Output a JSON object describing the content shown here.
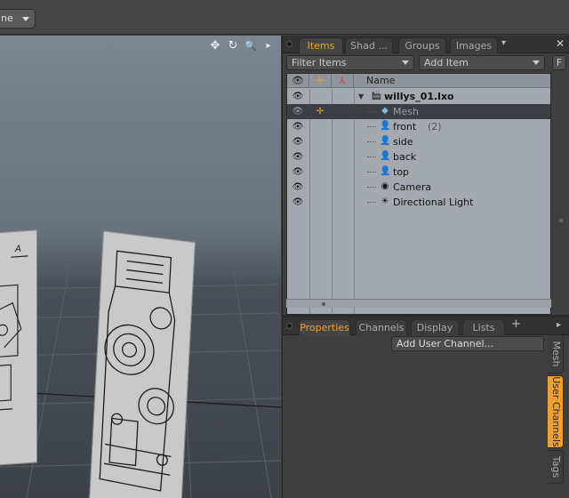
{
  "toolbar": {
    "mode_label": "ne"
  },
  "viewport": {
    "tools": [
      {
        "name": "move-view-icon",
        "glyph": "✥"
      },
      {
        "name": "rotate-view-icon",
        "glyph": "↻"
      },
      {
        "name": "zoom-view-icon",
        "glyph": "🔍"
      },
      {
        "name": "viewport-menu-icon",
        "glyph": "▸"
      }
    ],
    "annotation": "A"
  },
  "top_tabs": {
    "items": [
      {
        "label": "Items",
        "active": true
      },
      {
        "label": "Shad ...",
        "active": false
      },
      {
        "label": "Groups",
        "active": false
      },
      {
        "label": "Images",
        "active": false
      }
    ],
    "more_glyph": "▾",
    "close_glyph": "✕"
  },
  "filter": {
    "filter_label": "Filter Items",
    "add_label": "Add Item",
    "f_label": "F"
  },
  "tree": {
    "header": {
      "name_label": "Name"
    },
    "header_icons": [
      "eye-icon",
      "lock-icon",
      "axes-icon"
    ],
    "colors": {
      "selected_row": "#3b3f44",
      "accent": "#f0a030",
      "bg": "#a3a9ae"
    },
    "rows": [
      {
        "label": "willys_01.lxo",
        "extra": "",
        "icon": "scene-icon",
        "glyph": "🎬",
        "indent": 0,
        "bold": true,
        "selected": false,
        "eye": true,
        "lock": false,
        "expand": true
      },
      {
        "label": "Mesh",
        "extra": "",
        "icon": "mesh-icon",
        "glyph": "◆",
        "indent": 1,
        "bold": false,
        "selected": true,
        "eye": true,
        "lock": true,
        "expand": false
      },
      {
        "label": "front",
        "extra": "(2)",
        "icon": "image-icon",
        "glyph": "👤",
        "indent": 1,
        "bold": false,
        "selected": false,
        "eye": true,
        "lock": false,
        "expand": false
      },
      {
        "label": "side",
        "extra": "",
        "icon": "image-icon",
        "glyph": "👤",
        "indent": 1,
        "bold": false,
        "selected": false,
        "eye": true,
        "lock": false,
        "expand": false
      },
      {
        "label": "back",
        "extra": "",
        "icon": "image-icon",
        "glyph": "👤",
        "indent": 1,
        "bold": false,
        "selected": false,
        "eye": true,
        "lock": false,
        "expand": false
      },
      {
        "label": "top",
        "extra": "",
        "icon": "image-icon",
        "glyph": "👤",
        "indent": 1,
        "bold": false,
        "selected": false,
        "eye": true,
        "lock": false,
        "expand": false
      },
      {
        "label": "Camera",
        "extra": "",
        "icon": "camera-icon",
        "glyph": "◉",
        "indent": 1,
        "bold": false,
        "selected": false,
        "eye": true,
        "lock": false,
        "expand": false
      },
      {
        "label": "Directional Light",
        "extra": "",
        "icon": "light-icon",
        "glyph": "☀",
        "indent": 1,
        "bold": false,
        "selected": false,
        "eye": true,
        "lock": false,
        "expand": false
      }
    ]
  },
  "bottom_tabs": {
    "items": [
      {
        "label": "Properties",
        "active": true
      },
      {
        "label": "Channels",
        "active": false
      },
      {
        "label": "Display",
        "active": false
      },
      {
        "label": "Lists",
        "active": false
      }
    ],
    "plus_glyph": "+",
    "more_glyph": "▸"
  },
  "properties": {
    "add_channel_label": "Add User Channel...",
    "side_tabs": [
      {
        "label": "Mesh",
        "active": false
      },
      {
        "label": "User Channels",
        "active": true
      },
      {
        "label": "Tags",
        "active": false
      }
    ]
  }
}
